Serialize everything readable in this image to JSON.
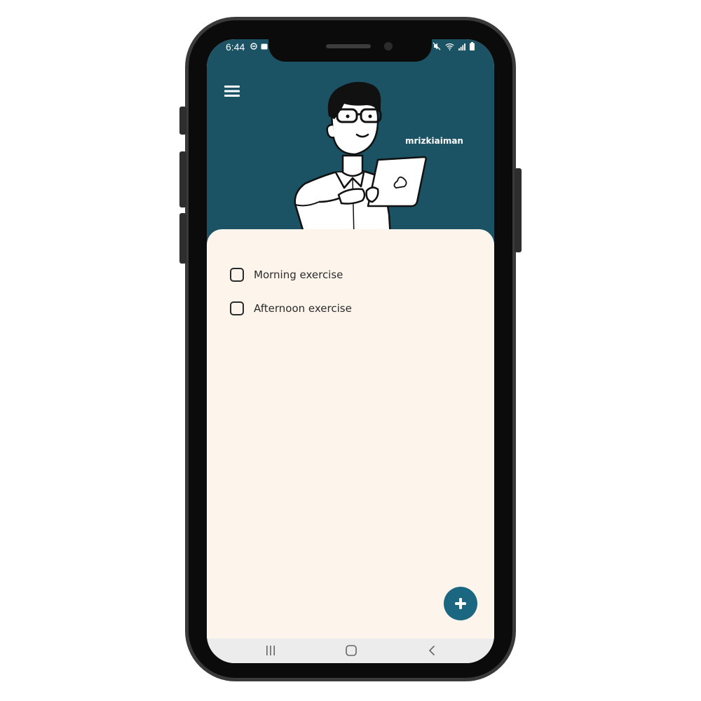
{
  "status_bar": {
    "time": "6:44",
    "left_icons": [
      "do-not-disturb-icon",
      "notification-icon"
    ],
    "right_icons": [
      "mute-icon",
      "wifi-icon",
      "signal-icon",
      "battery-icon"
    ]
  },
  "header": {
    "menu_icon": "hamburger-menu-icon",
    "username": "mrizkiaiman",
    "background_color": "#1b5264"
  },
  "tasks": [
    {
      "label": "Morning exercise",
      "checked": false
    },
    {
      "label": "Afternoon exercise",
      "checked": false
    }
  ],
  "fab": {
    "icon": "plus-icon",
    "color": "#1b6680"
  },
  "navbar": {
    "buttons": [
      "recent-apps-icon",
      "home-icon",
      "back-icon"
    ]
  },
  "colors": {
    "content_background": "#fdf5ec",
    "text": "#2b2b2b"
  }
}
